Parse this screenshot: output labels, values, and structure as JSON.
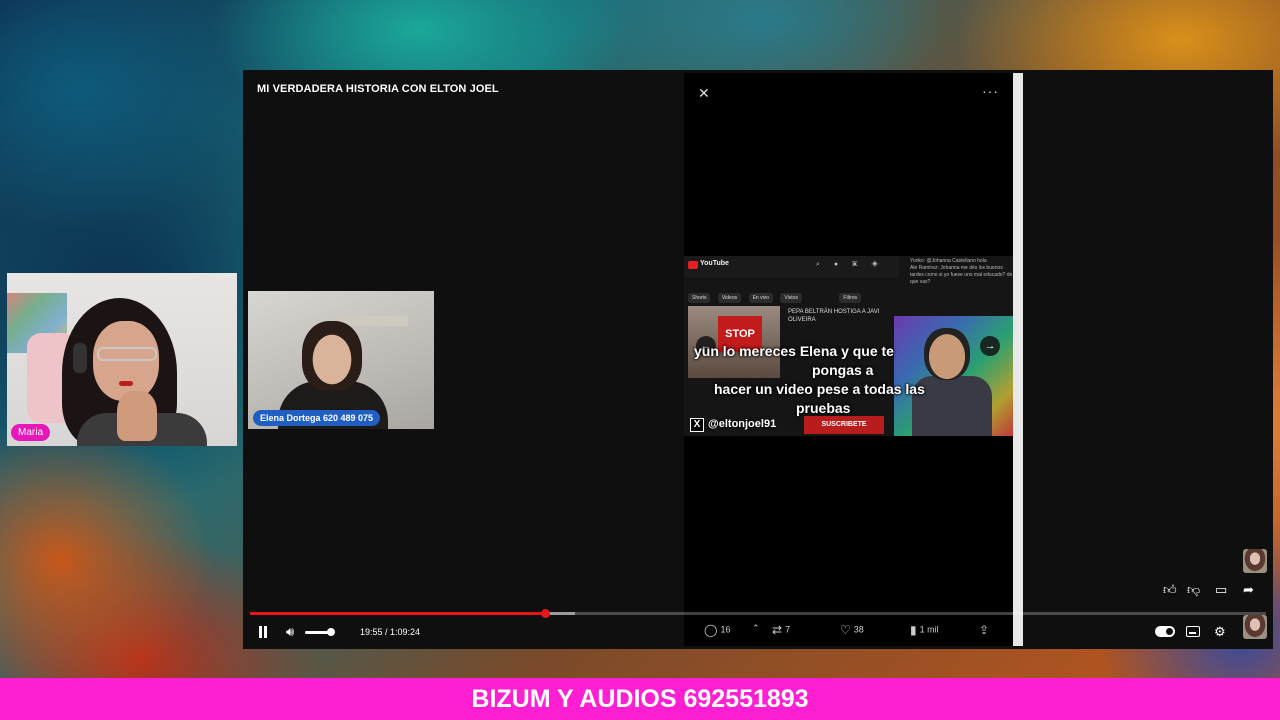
{
  "player": {
    "title": "MI VERDADERA HISTORIA CON ELTON JOEL",
    "time": "19:55 / 1:09:24",
    "progress": 0.29,
    "buffered": 0.32,
    "volume": 0.85
  },
  "guest_cam": {
    "name_tag": "Elena Dortega 620 489 075"
  },
  "clip": {
    "close_icon": "✕",
    "more_icon": "···",
    "subtitle_line1": "yun lo mereces Elena y que te",
    "subtitle_line2": "pongas a",
    "subtitle_line3": "hacer un video pese a todas las",
    "subtitle_line4": "pruebas",
    "handle": "@eltonjoel91",
    "x_logo": "X",
    "yt_logo_text": "YouTube",
    "chips": [
      "Shorts",
      "Videos",
      "En vivo",
      "Vistos",
      "Filtros"
    ],
    "video_title": "PEPA BELTRÁN HOSTIGA A JAVI OLIVEIRA",
    "stop_sign": "STOP",
    "subscribe_strip": "SUSCRIBETE",
    "chat_line1": "Yoriko: @Johanna Castellano hola",
    "chat_line2": "Ale Ramírez: Johanna me dés los buenos tardes como si yo fuese uno mal educado? de que vas?",
    "actions": {
      "replies": "16",
      "reposts": "7",
      "likes": "38",
      "views": "1 mil"
    }
  },
  "webcam": {
    "name_tag": "Maria"
  },
  "banner": {
    "text": "BIZUM Y AUDIOS 692551893"
  },
  "colors": {
    "banner": "#ff1fd2",
    "progress": "#e31818",
    "guest_tag": "#1f5fc4",
    "webcam_tag": "#e618b9"
  }
}
